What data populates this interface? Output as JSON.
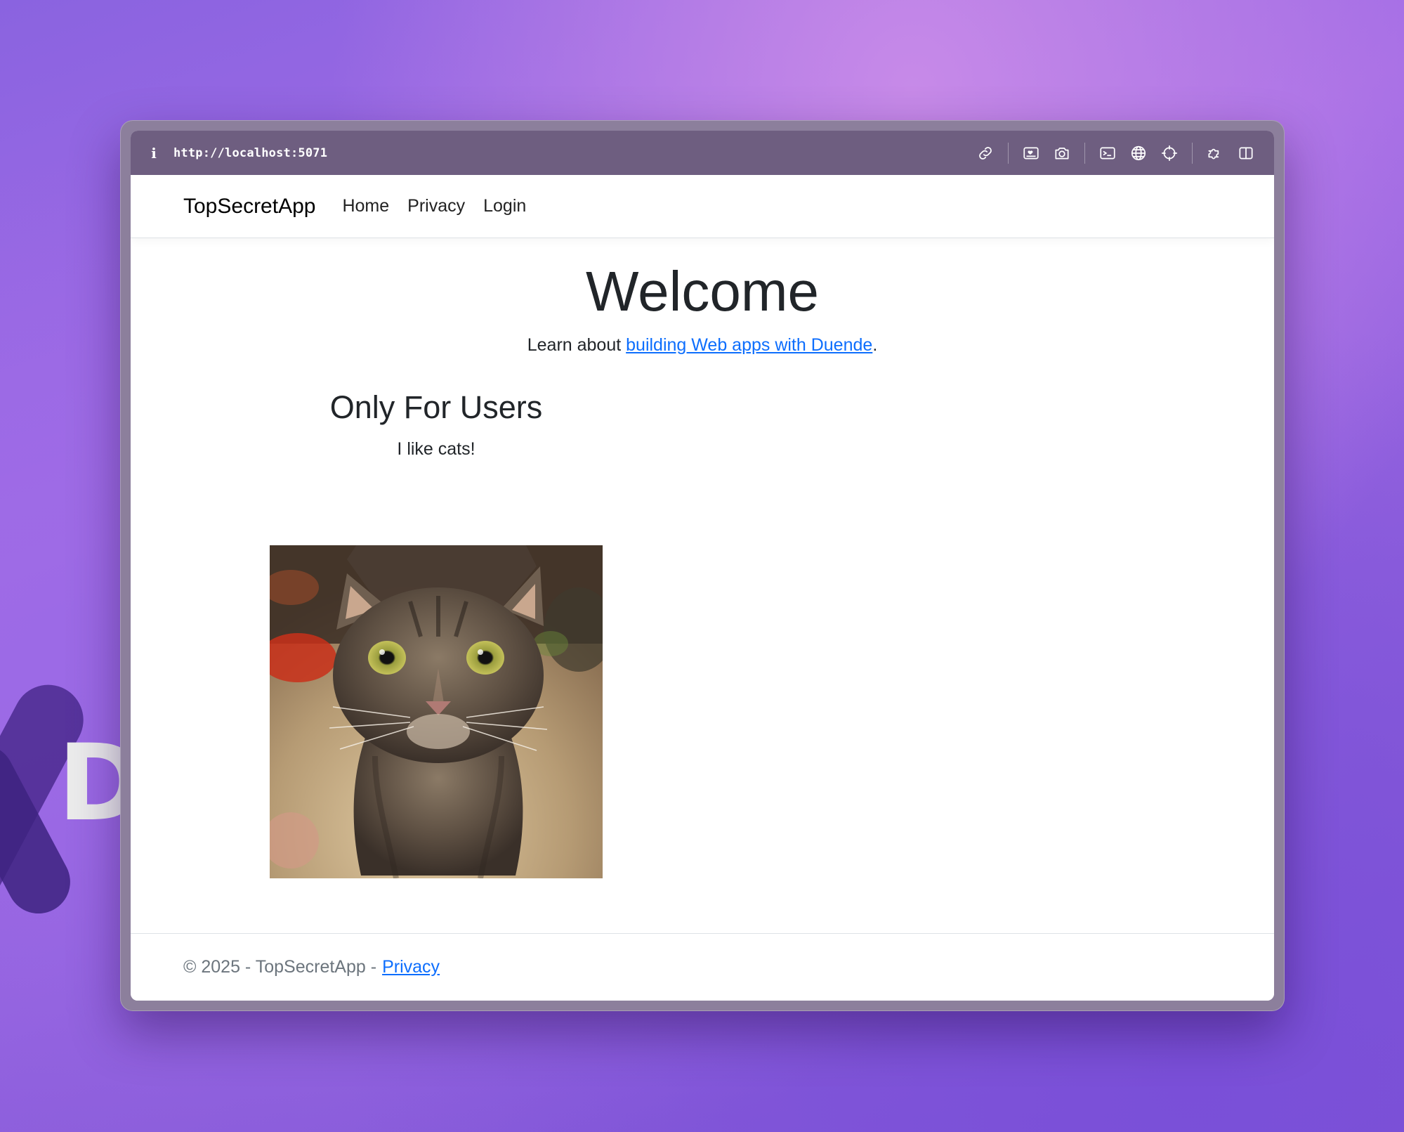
{
  "browser": {
    "url": "http://localhost:5071"
  },
  "nav": {
    "brand": "TopSecretApp",
    "links": [
      "Home",
      "Privacy",
      "Login"
    ]
  },
  "main": {
    "title": "Welcome",
    "lead_prefix": "Learn about ",
    "lead_link": "building Web apps with Duende",
    "lead_suffix": ".",
    "section_title": "Only For Users",
    "section_text": "I like cats!",
    "image_alt": "cat photo"
  },
  "footer": {
    "text": "© 2025 - TopSecretApp -",
    "link": "Privacy"
  },
  "background": {
    "logo_letter": "D"
  },
  "icons": [
    "info-icon",
    "link-icon",
    "image-icon",
    "camera-icon",
    "terminal-icon",
    "globe-icon",
    "crosshair-icon",
    "puzzle-icon",
    "sidebar-icon"
  ],
  "colors": {
    "link": "#0d6efd",
    "toolbar": "#6e5e80",
    "text": "#212529"
  }
}
